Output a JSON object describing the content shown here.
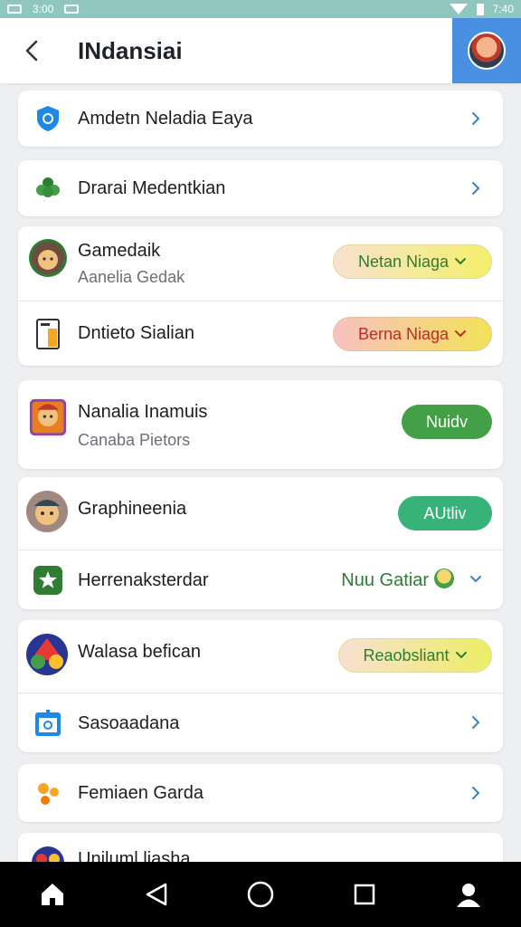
{
  "status_bar": {
    "left_time": "3:00",
    "right_time": "7:40"
  },
  "header": {
    "title": "INdansiai"
  },
  "items": {
    "r1": {
      "title": "Amdetn Neladia Eaya"
    },
    "r2": {
      "title": "Drarai Medentkian"
    },
    "r3": {
      "title": "Gamedaik",
      "subtitle": "Aanelia Gedak",
      "pill": "Netan Niaga"
    },
    "r4": {
      "title": "Dntieto Sialian",
      "pill": "Berna Niaga"
    },
    "r5": {
      "title": "Nanalia Inamuis",
      "subtitle": "Canaba Pietors",
      "pill": "Nuidv"
    },
    "r6": {
      "title": "Graphineenia",
      "pill": "AUtliv"
    },
    "r7": {
      "title": "Herrenaksterdar",
      "status": "Nuu Gatiar"
    },
    "r8": {
      "title": "Walasa befican",
      "pill": "Reaobsliant"
    },
    "r9": {
      "title": "Sasoaadana"
    },
    "r10": {
      "title": "Femiaen Garda"
    },
    "r11": {
      "title": "Uniluml liasha"
    }
  },
  "icons": {
    "status_left": [
      "image-icon",
      "image-icon"
    ],
    "status_right": [
      "wifi-icon",
      "battery-icon"
    ],
    "header_back": "back-arrow-icon",
    "header_avatar": "avatar-icon",
    "r1": "shield-app-icon",
    "r2": "leaf-app-icon",
    "r3": "character-avatar-icon",
    "r4": "document-app-icon",
    "r5": "game-art-icon",
    "r6": "character-avatar-icon",
    "r7": "star-app-icon",
    "r8": "colorful-app-icon",
    "r9": "calendar-app-icon",
    "r10": "flower-app-icon",
    "r11": "colorful-app-icon",
    "nav": [
      "home-icon",
      "back-icon",
      "home-circle-icon",
      "recents-icon",
      "profile-icon"
    ]
  },
  "colors": {
    "status_bar": "#8fc7c0",
    "avatar_bg": "#4a90e2",
    "accent_blue": "#1976d2",
    "accent_green": "#43a047"
  }
}
